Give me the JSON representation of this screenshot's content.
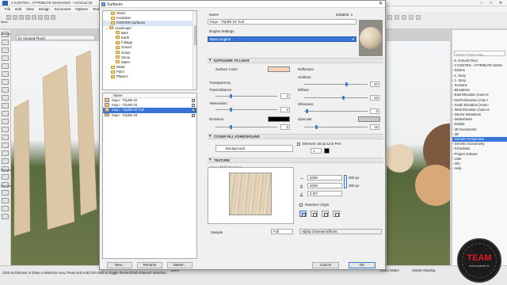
{
  "app": {
    "title": "2 KONTEN - ATTRIBUTE MANAGER - Archicad 26",
    "menus": [
      "File",
      "Edit",
      "View",
      "Design",
      "Document",
      "Options",
      "Teamwork",
      "Window",
      "Help"
    ],
    "main_label": "Main:",
    "view_tab": "[0. Ground Floor]",
    "toolbox_label": "Design",
    "toolbox_label2": "Viewpoint",
    "toolbox_label3": "Document"
  },
  "navigator": {
    "search_placeholder": "Search Project Map",
    "items": [
      "0. Ground Floor",
      "2 KONTEN - ATTRIBUTE MANA",
      "Stories",
      "2. Story",
      "1. Story",
      "Sections",
      "Elevations",
      "East Elevation (Auto-re",
      "North Elevation (Auto-r",
      "South Elevation (Auto-r",
      "West Elevation (Auto-re",
      "Interior Elevations",
      "Worksheets",
      "Details",
      "3D Documents",
      "3D",
      "Generic Perspective",
      "Generic Axonometry",
      "Schedules",
      "Project Indexes",
      "Lists",
      "Info",
      "Help"
    ],
    "selected_index": 16
  },
  "status": {
    "message": "Click an Element or Draw a Selection Area. Press and Hold Ctrl+Shift to Toggle Element/Sub-Element Selection.",
    "zoom": "100%",
    "model_view": "Entire Model",
    "structure": "Simple Shading"
  },
  "brand": {
    "name": "TEAM",
    "sub": "www.myteam.tv"
  },
  "dialog": {
    "title": "Surfaces",
    "tree": [
      {
        "label": "Glass",
        "indent": 1,
        "selected": false
      },
      {
        "label": "Insulation",
        "indent": 1,
        "selected": false
      },
      {
        "label": "KONTEN Surfaces",
        "indent": 1,
        "selected": true
      },
      {
        "label": "Landscape",
        "indent": 0,
        "selected": false
      },
      {
        "label": "Bark",
        "indent": 2,
        "selected": false
      },
      {
        "label": "Earth",
        "indent": 2,
        "selected": false
      },
      {
        "label": "Foliage",
        "indent": 2,
        "selected": false
      },
      {
        "label": "Gravel",
        "indent": 2,
        "selected": false
      },
      {
        "label": "Grass",
        "indent": 2,
        "selected": false
      },
      {
        "label": "Stone",
        "indent": 2,
        "selected": false
      },
      {
        "label": "Water",
        "indent": 2,
        "selected": false
      },
      {
        "label": "Metal",
        "indent": 1,
        "selected": false
      },
      {
        "label": "Paint",
        "indent": 1,
        "selected": false
      },
      {
        "label": "Plastics",
        "indent": 1,
        "selected": false
      }
    ],
    "items_header": "Name",
    "items": [
      {
        "label": "Kayu - Triplek 01",
        "selected": false
      },
      {
        "label": "Kayu - Triplek 02",
        "selected": false
      },
      {
        "label": "Kayu - Triplek 02 Tool",
        "selected": true
      },
      {
        "label": "Kayu - Triplek 03",
        "selected": false
      }
    ],
    "buttons": {
      "new": "New...",
      "rename": "Rename",
      "delete": "Delete...",
      "cancel": "Cancel",
      "ok": "OK"
    },
    "name_label": "Name",
    "editable": "Editable: 1",
    "name_value": "Kayu - Triplek 02 Tool",
    "engine_label": "Engine Settings",
    "engine_value": "Basic Engine",
    "sections": {
      "exposure": "EXPOSURE TO LIGHT",
      "cover_fill": "COVER FILL FOREGROUND",
      "texture": "TEXTURE"
    },
    "exposure": {
      "surface_color_label": "Surface Color:",
      "surface_color": "#f7d2b8",
      "transparency": "Transparency",
      "transmittance": "Transmittance",
      "transmittance_value": "0",
      "attenuation": "Attenuation",
      "attenuation_value": "0",
      "emission": "Emission",
      "emission_value": "0",
      "emission_color": "#000000",
      "reflection": "Reflection",
      "ambient": "Ambient",
      "ambient_value": "67",
      "diffuse": "Diffuse",
      "diffuse_value": "62",
      "shininess": "Shininess",
      "shininess_value": "0",
      "specular": "Specular",
      "specular_value": "16",
      "specular_color": "#c8c8c8"
    },
    "cover": {
      "pattern": "Background",
      "uncut_line_pen_label": "Element Uncut Line Pen",
      "pen_value": "1"
    },
    "texture": {
      "file_name": "Kayu-fimform-2.png",
      "width": "2000",
      "height": "2000",
      "width_px": "300 px",
      "height_px": "300 px",
      "angle": "0.00°",
      "random_origin": "Random Origin",
      "sample_label": "Sample",
      "sample_value": "Full",
      "alpha_effects": "Alpha Channel Effects"
    }
  }
}
